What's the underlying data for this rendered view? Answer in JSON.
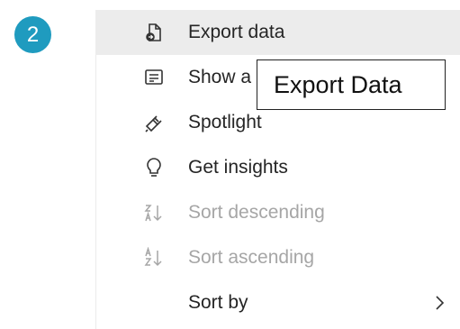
{
  "step_badge": "2",
  "menu": {
    "items": [
      {
        "label": "Export data",
        "icon": "export-icon",
        "state": "hover"
      },
      {
        "label": "Show a",
        "icon": "show-as-table-icon",
        "state": "enabled"
      },
      {
        "label": "Spotlight",
        "icon": "spotlight-icon",
        "state": "enabled"
      },
      {
        "label": "Get insights",
        "icon": "lightbulb-icon",
        "state": "enabled"
      },
      {
        "label": "Sort descending",
        "icon": "sort-descending-icon",
        "state": "disabled"
      },
      {
        "label": "Sort ascending",
        "icon": "sort-ascending-icon",
        "state": "disabled"
      },
      {
        "label": "Sort by",
        "icon": "chevron-right-icon",
        "state": "enabled"
      }
    ]
  },
  "tooltip": "Export Data",
  "colors": {
    "badge": "#1f9bbf",
    "hover_background": "#ececec",
    "text": "#252525",
    "disabled_text": "#a6a6a6"
  }
}
